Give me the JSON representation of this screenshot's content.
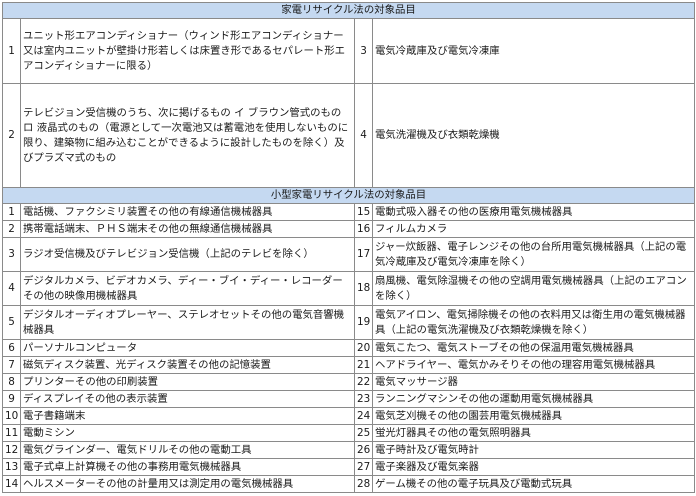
{
  "large": {
    "title": "家電リサイクル法の対象品目",
    "items": [
      {
        "no": "1",
        "text": "ユニット形エアコンディショナー（ウィンド形エアコンディショナー又は室内ユニットが壁掛け形若しくは床置き形であるセパレート形エアコンディショナーに限る）"
      },
      {
        "no": "2",
        "text": "テレビジョン受信機のうち、次に掲げるもの イ ブラウン管式のもの ロ 液晶式のもの（電源として一次電池又は蓄電池を使用しないものに限り、建築物に組み込むことができるように設計したものを除く）及びプラズマ式のもの"
      },
      {
        "no": "3",
        "text": "電気冷蔵庫及び電気冷凍庫"
      },
      {
        "no": "4",
        "text": "電気洗濯機及び衣類乾燥機"
      }
    ]
  },
  "small": {
    "title": "小型家電リサイクル法の対象品目",
    "rows": [
      {
        "left": {
          "no": "1",
          "text": "電話機、ファクシミリ装置その他の有線通信機械器具"
        },
        "right": {
          "no": "15",
          "text": "電動式吸入器その他の医療用電気機械器具"
        }
      },
      {
        "left": {
          "no": "2",
          "text": "携帯電話端末、ＰＨＳ端末その他の無線通信機械器具"
        },
        "right": {
          "no": "16",
          "text": "フィルムカメラ"
        }
      },
      {
        "left": {
          "no": "3",
          "text": "ラジオ受信機及びテレビジョン受信機（上記のテレビを除く）"
        },
        "right": {
          "no": "17",
          "text": "ジャー炊飯器、電子レンジその他の台所用電気機械器具（上記の電気冷蔵庫及び電気冷凍庫を除く）"
        }
      },
      {
        "left": {
          "no": "4",
          "text": "デジタルカメラ、ビデオカメラ、ディー・ブイ・ディー・レコーダーその他の映像用機械器具"
        },
        "right": {
          "no": "18",
          "text": "扇風機、電気除湿機その他の空調用電気機械器具（上記のエアコンを除く）"
        }
      },
      {
        "left": {
          "no": "5",
          "text": "デジタルオーディオプレーヤー、ステレオセットその他の電気音響機械器具"
        },
        "right": {
          "no": "19",
          "text": "電気アイロン、電気掃除機その他の衣料用又は衛生用の電気機械器具（上記の電気洗濯機及び衣類乾燥機を除く）"
        }
      },
      {
        "left": {
          "no": "6",
          "text": "パーソナルコンピュータ"
        },
        "right": {
          "no": "20",
          "text": "電気こたつ、電気ストーブその他の保温用電気機械器具"
        }
      },
      {
        "left": {
          "no": "7",
          "text": "磁気ディスク装置、光ディスク装置その他の記憶装置"
        },
        "right": {
          "no": "21",
          "text": "ヘアドライヤー、電気かみそりその他の理容用電気機械器具"
        }
      },
      {
        "left": {
          "no": "8",
          "text": "プリンターその他の印刷装置"
        },
        "right": {
          "no": "22",
          "text": "電気マッサージ器"
        }
      },
      {
        "left": {
          "no": "9",
          "text": "ディスプレイその他の表示装置"
        },
        "right": {
          "no": "23",
          "text": "ランニングマシンその他の運動用電気機械器具"
        }
      },
      {
        "left": {
          "no": "10",
          "text": "電子書籍端末"
        },
        "right": {
          "no": "24",
          "text": "電気芝刈機その他の園芸用電気機械器具"
        }
      },
      {
        "left": {
          "no": "11",
          "text": "電動ミシン"
        },
        "right": {
          "no": "25",
          "text": "蛍光灯器具その他の電気照明器具"
        }
      },
      {
        "left": {
          "no": "12",
          "text": "電気グラインダー、電気ドリルその他の電動工具"
        },
        "right": {
          "no": "26",
          "text": "電子時計及び電気時計"
        }
      },
      {
        "left": {
          "no": "13",
          "text": "電子式卓上計算機その他の事務用電気機械器具"
        },
        "right": {
          "no": "27",
          "text": "電子楽器及び電気楽器"
        }
      },
      {
        "left": {
          "no": "14",
          "text": "ヘルスメーターその他の計量用又は測定用の電気機械器具"
        },
        "right": {
          "no": "28",
          "text": "ゲーム機その他の電子玩具及び電動式玩具"
        }
      }
    ]
  },
  "colors": {
    "header_bg": "#c5d9f1",
    "border": "#8a8a8a",
    "text": "#1a1a1a"
  }
}
